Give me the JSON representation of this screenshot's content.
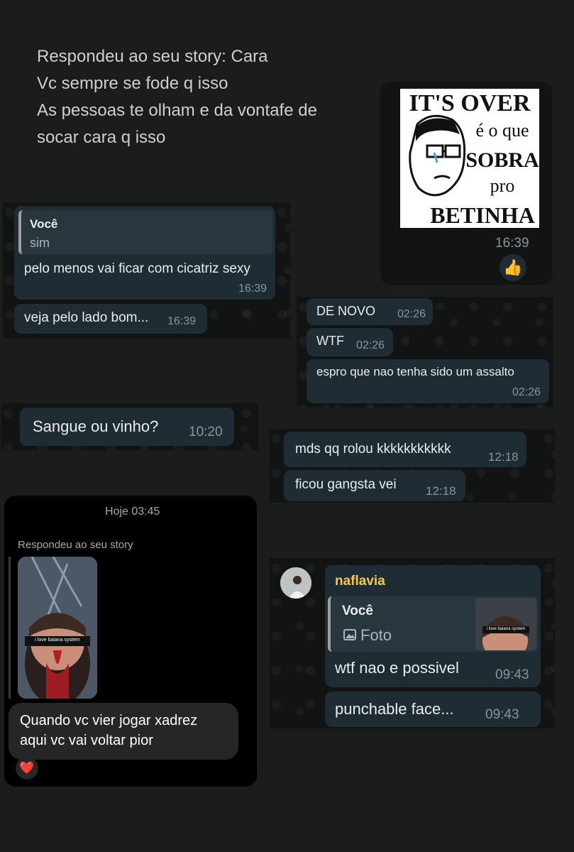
{
  "story_reply": {
    "lines": [
      "Respondeu ao seu story: Cara",
      "Vc sempre se fode q isso",
      "As pessoas te olham e da vontafe de",
      "socar cara q isso"
    ]
  },
  "sticker": {
    "lines": [
      "IT'S OVER",
      "é o que",
      "SOBRA",
      "pro",
      "BETINHA"
    ],
    "time": "16:39",
    "reaction": "👍"
  },
  "chat1": {
    "quote_author": "Você",
    "quote_text": "sim",
    "message1": "pelo menos vai ficar com cicatriz sexy",
    "time1": "16:39",
    "message2": "veja pelo lado bom...",
    "time2": "16:39"
  },
  "chat2": {
    "messages": [
      {
        "text": "DE NOVO",
        "time": "02:26"
      },
      {
        "text": "WTF",
        "time": "02:26"
      },
      {
        "text": "espro que nao tenha sido um assalto",
        "time": "02:26"
      }
    ]
  },
  "chat3": {
    "text": "Sangue ou vinho?",
    "time": "10:20"
  },
  "chat4": {
    "messages": [
      {
        "text": "mds qq rolou kkkkkkkkkkk",
        "time": "12:18"
      },
      {
        "text": "ficou gangsta vei",
        "time": "12:18"
      }
    ]
  },
  "ig": {
    "date": "Hoje 03:45",
    "label": "Respondeu ao seu story",
    "image_caption": "i love baiana system",
    "message_line1": "Quando vc vier jogar xadrez",
    "message_line2": "aqui vc vai voltar pior",
    "reaction": "❤️"
  },
  "chat5": {
    "sender": "naflavia",
    "quote_author": "Você",
    "quote_icon": "image-icon",
    "quote_text": "Foto",
    "thumb_caption": "i love baiana system",
    "message1": "wtf nao e possivel",
    "time1": "09:43",
    "message2": "punchable face...",
    "time2": "09:43"
  },
  "colors": {
    "background": "#1b1c1c",
    "bubble": "#1f2c34",
    "chat_bg": "#121414",
    "timestamp": "#8696a0",
    "sender_name": "#f2c94c",
    "quote_bar": "#9e9e9e"
  }
}
